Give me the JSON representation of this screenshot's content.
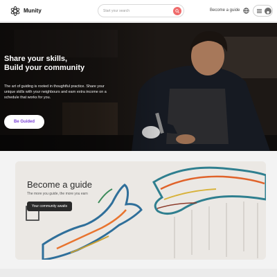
{
  "header": {
    "brand": "Munity",
    "search_placeholder": "Start your search",
    "become_guide": "Become a guide",
    "icons": [
      "munity-logo-icon",
      "search-icon",
      "globe-icon",
      "menu-icon",
      "user-icon"
    ]
  },
  "hero": {
    "title_line1": "Share your skills,",
    "title_line2": "Build your community",
    "text": "The art of guiding is rooted in thoughtful practice. Share your unique skills with your neighbours and earn extra income on a schedule that works for you.",
    "button": "Be Guided"
  },
  "guide_card": {
    "title": "Become a guide",
    "subtitle": "The more you guide, the more you earn",
    "button": "Your community awaits"
  },
  "colors": {
    "accent_purple": "#7a3fd6",
    "search_button": "#ef6b6b",
    "dark_button": "#2a2a2a"
  }
}
